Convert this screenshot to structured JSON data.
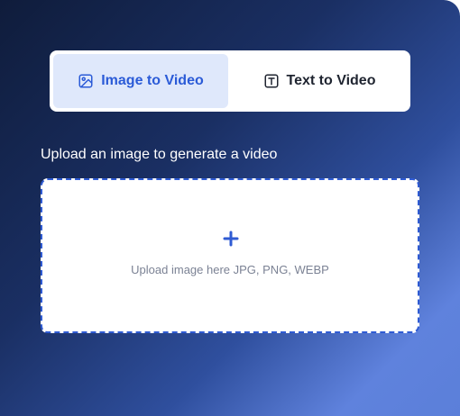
{
  "tabs": [
    {
      "label": "Image to Video",
      "icon": "image-icon",
      "active": true
    },
    {
      "label": "Text to Video",
      "icon": "text-box-icon",
      "active": false
    }
  ],
  "upload": {
    "prompt": "Upload an image to generate a video",
    "hint": "Upload image here JPG, PNG, WEBP",
    "icon": "plus-icon"
  },
  "colors": {
    "accent": "#2b5bd7",
    "active_tab_bg": "#dfe8fb",
    "hint_text": "#7b8294"
  }
}
